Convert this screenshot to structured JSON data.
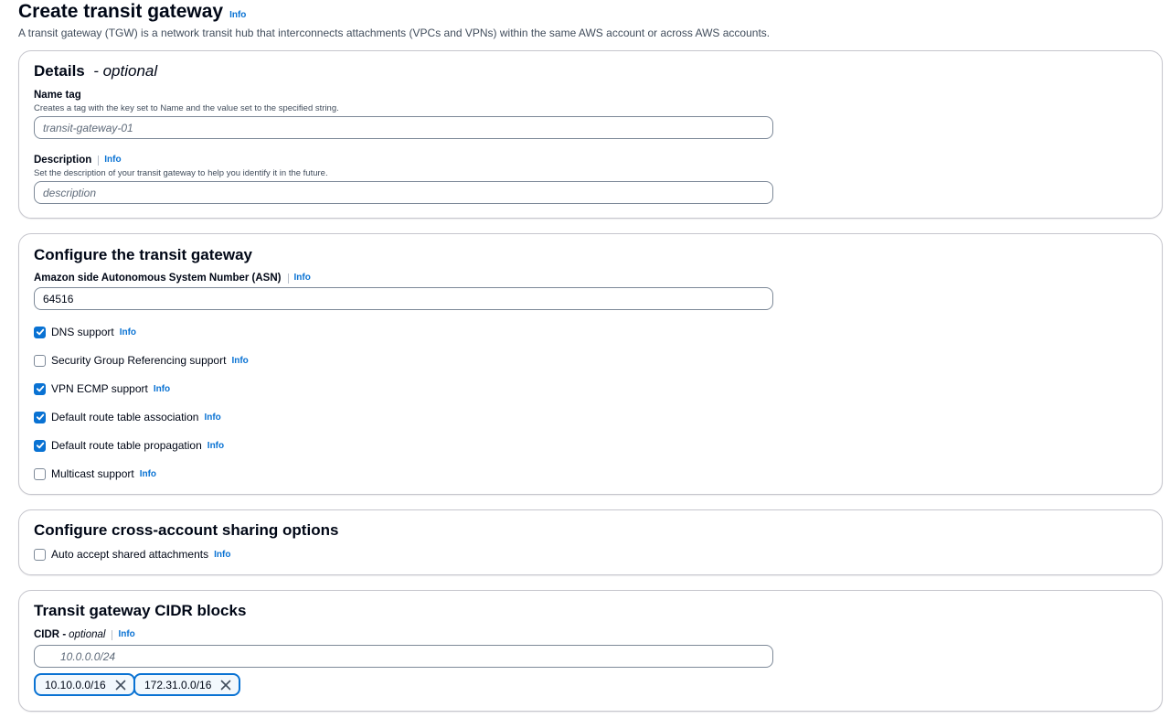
{
  "header": {
    "title": "Create transit gateway",
    "info": "Info",
    "description": "A transit gateway (TGW) is a network transit hub that interconnects attachments (VPCs and VPNs) within the same AWS account or across AWS accounts."
  },
  "details": {
    "title": "Details",
    "title_suffix": "- optional",
    "name_tag": {
      "label": "Name tag",
      "hint": "Creates a tag with the key set to Name and the value set to the specified string.",
      "placeholder": "transit-gateway-01",
      "value": ""
    },
    "description": {
      "label": "Description",
      "info": "Info",
      "hint": "Set the description of your transit gateway to help you identify it in the future.",
      "placeholder": "description",
      "value": ""
    }
  },
  "configure": {
    "title": "Configure the transit gateway",
    "asn": {
      "label": "Amazon side Autonomous System Number (ASN)",
      "info": "Info",
      "value": "64516"
    },
    "options": [
      {
        "label": "DNS support",
        "info": "Info",
        "checked": true
      },
      {
        "label": "Security Group Referencing support",
        "info": "Info",
        "checked": false
      },
      {
        "label": "VPN ECMP support",
        "info": "Info",
        "checked": true
      },
      {
        "label": "Default route table association",
        "info": "Info",
        "checked": true
      },
      {
        "label": "Default route table propagation",
        "info": "Info",
        "checked": true
      },
      {
        "label": "Multicast support",
        "info": "Info",
        "checked": false
      }
    ]
  },
  "sharing": {
    "title": "Configure cross-account sharing options",
    "options": [
      {
        "label": "Auto accept shared attachments",
        "info": "Info",
        "checked": false
      }
    ]
  },
  "cidr": {
    "title": "Transit gateway CIDR blocks",
    "label": "CIDR",
    "label_suffix": "optional",
    "info": "Info",
    "placeholder": "10.0.0.0/24",
    "tokens": [
      "10.10.0.0/16",
      "172.31.0.0/16"
    ]
  },
  "colors": {
    "link": "#0972d3",
    "text": "#000716",
    "border": "#c6c6cd",
    "checkbox_checked": "#0972d3"
  },
  "icons": {
    "search": "search-icon",
    "dismiss": "close-icon",
    "check": "check-icon"
  }
}
